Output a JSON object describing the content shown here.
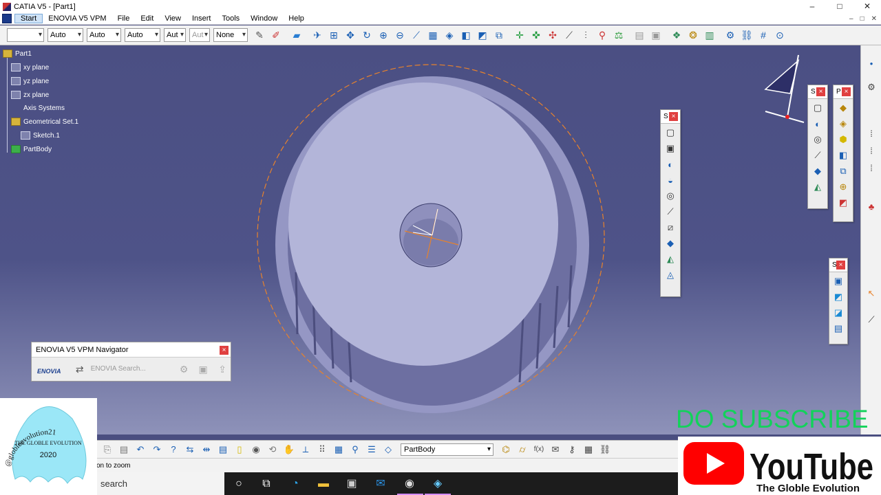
{
  "window": {
    "title": "CATIA V5 - [Part1]",
    "controls": [
      "–",
      "□",
      "✕"
    ]
  },
  "menubar": {
    "items": [
      "Start",
      "ENOVIA V5 VPM",
      "File",
      "Edit",
      "View",
      "Insert",
      "Tools",
      "Window",
      "Help"
    ],
    "doc_controls": [
      "–",
      "□",
      "✕"
    ]
  },
  "toolbar": {
    "selects": [
      "",
      "Auto",
      "Auto",
      "Auto",
      "Aut",
      "Aut",
      "None"
    ]
  },
  "tree": {
    "items": [
      "Part1",
      "xy plane",
      "yz plane",
      "zx plane",
      "Axis Systems",
      "Geometrical Set.1",
      "Sketch.1",
      "PartBody"
    ]
  },
  "palettes": {
    "p1_title": "S",
    "p2_title": "S",
    "p3_title": "P",
    "p4_title": "S",
    "close": "×"
  },
  "enovia": {
    "title": "ENOVIA V5 VPM Navigator",
    "logo": "ENOVIA",
    "search_label": "ENOVIA Search...",
    "close": "×"
  },
  "bottombar": {
    "current_body": "PartBody",
    "fx_label": "f(x)"
  },
  "statusbar": {
    "text": "on to zoom"
  },
  "taskbar": {
    "search_text": "search"
  },
  "overlay": {
    "subscribe": "DO SUBSCRIBE",
    "youtube": "YouTube",
    "channel": "The Globle Evolution",
    "logo_name": "THE GLOBLE EVOLUTION",
    "logo_year": "2020",
    "logo_handle": "@globleevolution21"
  },
  "colors": {
    "viewport_bg": "#4b4f83",
    "part_face": "#b3b5d9",
    "sketch_orange": "#e8822b",
    "subscribe_green": "#12d25a",
    "youtube_red": "#ff0000"
  }
}
